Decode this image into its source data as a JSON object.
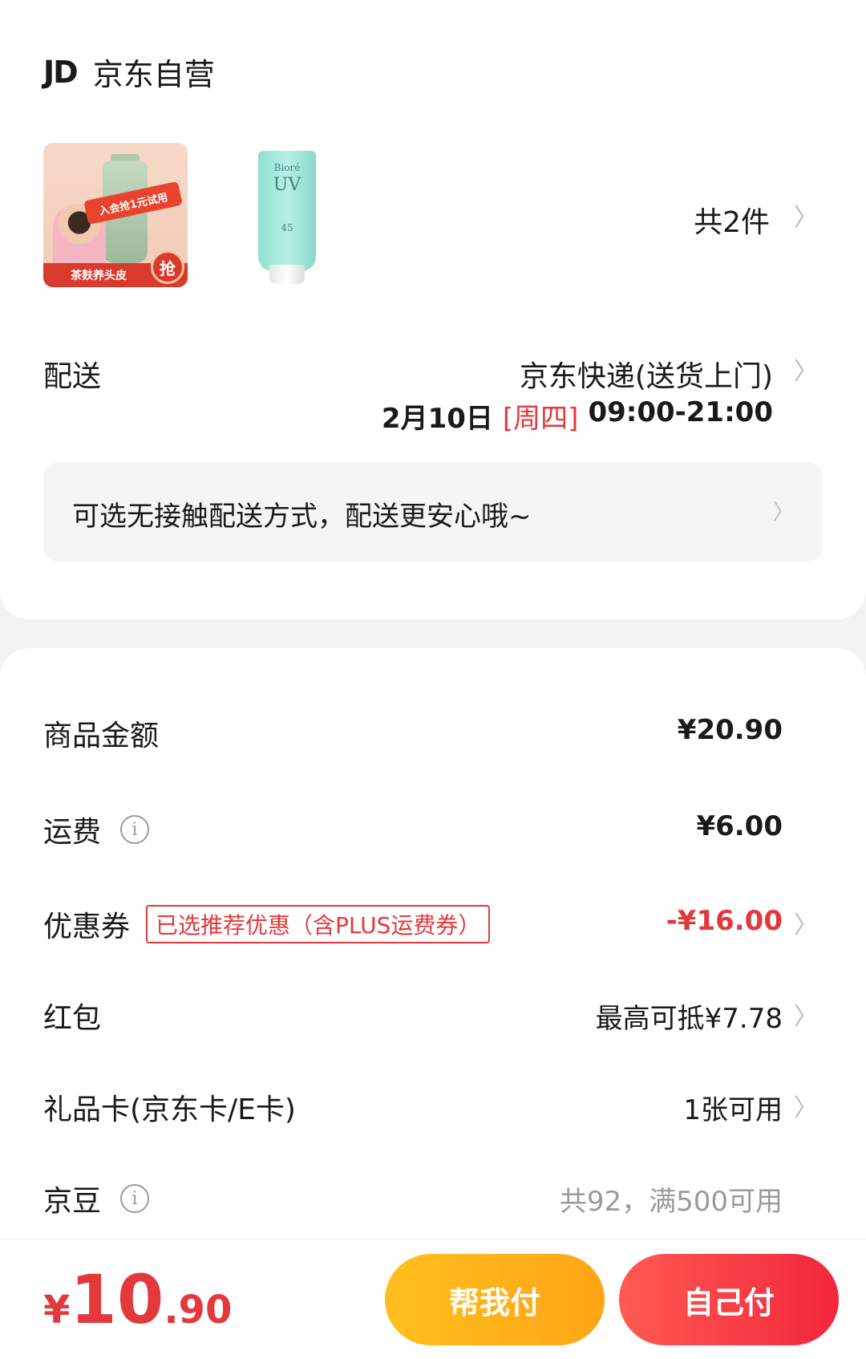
{
  "shop": {
    "logo": "JD",
    "name": "京东自营"
  },
  "items": {
    "thumb1": {
      "promo": "入会抢1元试用",
      "bottom_text": "茶麸养头皮",
      "grab": "抢"
    },
    "thumb2": {
      "brand": "Bioré",
      "uv": "UV",
      "spf": "45"
    },
    "count": "共2件"
  },
  "delivery": {
    "label": "配送",
    "method": "京东快递(送货上门)",
    "date": "2月10日",
    "weekday": "[周四]",
    "time": "09:00-21:00",
    "notice": "可选无接触配送方式，配送更安心哦~"
  },
  "price_rows": {
    "goods": {
      "label": "商品金额",
      "value": "¥20.90"
    },
    "shipping": {
      "label": "运费",
      "value": "¥6.00"
    },
    "coupon": {
      "label": "优惠券",
      "tag": "已选推荐优惠（含PLUS运费券）",
      "value": "-¥16.00"
    },
    "redpacket": {
      "label": "红包",
      "value": "最高可抵¥7.78"
    },
    "giftcard": {
      "label": "礼品卡(京东卡/E卡)",
      "value": "1张可用"
    },
    "jingdou": {
      "label": "京豆",
      "value": "共92，满500可用"
    }
  },
  "bottom": {
    "currency": "¥",
    "total_int": "10",
    "total_dec": ".90",
    "help_pay": "帮我付",
    "self_pay": "自己付"
  },
  "colors": {
    "accent_red": "#e4393c",
    "help_btn": "#ffb11a",
    "self_btn": "#f2273c"
  },
  "icons": {
    "chevron": "chevron-right-icon",
    "info": "info-icon"
  }
}
